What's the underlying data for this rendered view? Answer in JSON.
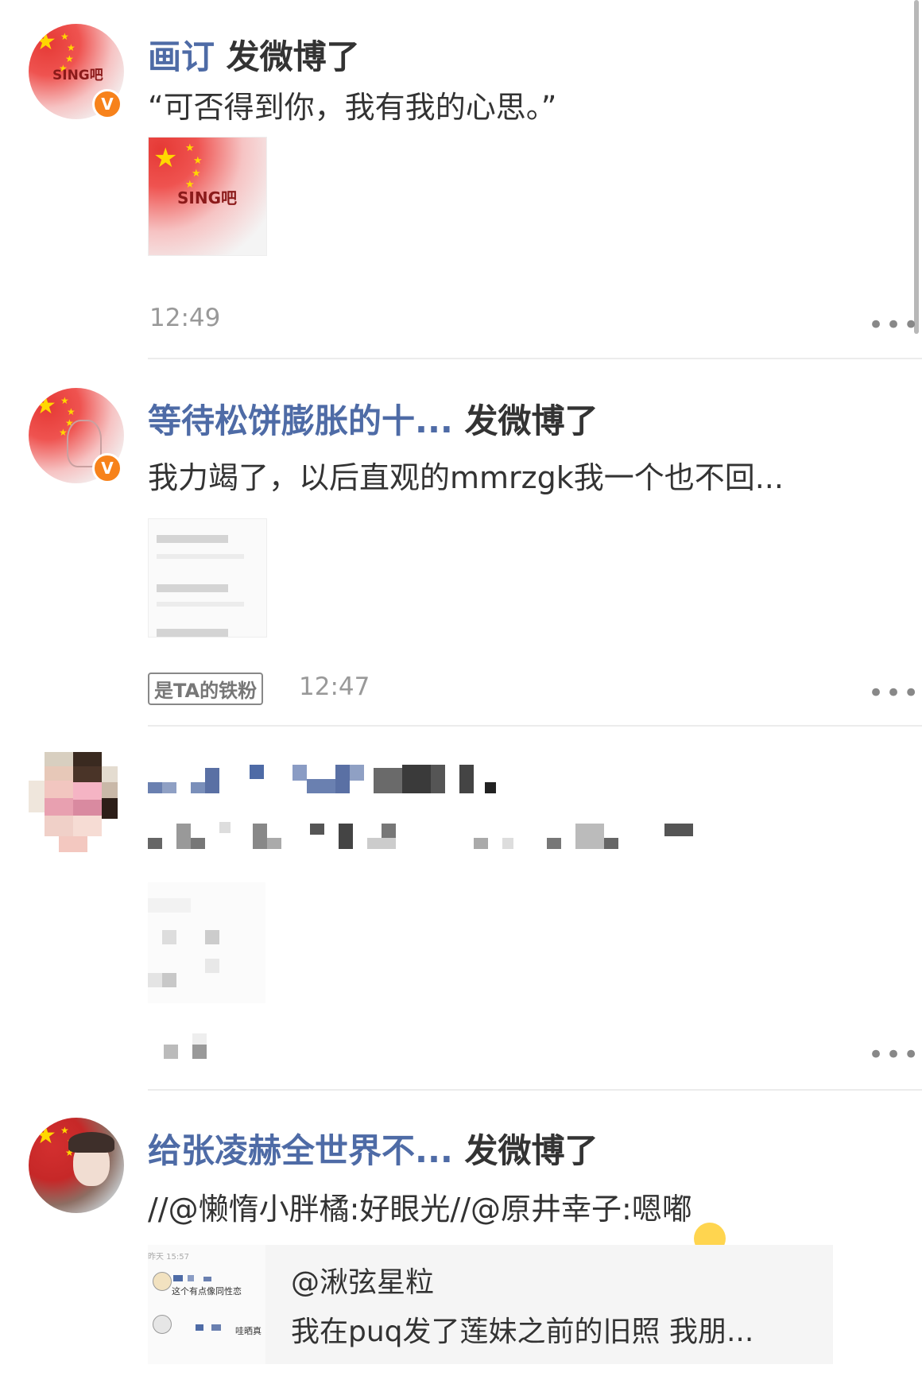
{
  "posts": [
    {
      "name": "画订",
      "action": "发微博了",
      "text": "“可否得到你，我有我的心思。”",
      "avatar_text": "SING吧",
      "image_text": "SING吧",
      "time": "12:49",
      "verified": "V"
    },
    {
      "name": "等待松饼膨胀的十...",
      "action": "发微博了",
      "text": "我力竭了，以后直观的mmrzgk我一个也不回...",
      "badge": "是TA的铁粉",
      "time": "12:47",
      "verified": "V"
    },
    {
      "name": "",
      "action": "",
      "text": ""
    },
    {
      "name": "给张凌赫全世界不...",
      "action": "发微博了",
      "text": "//@懒惰小胖橘:好眼光//@原井幸子:嗯嘟",
      "emoji": "😊",
      "repost": {
        "mention": "@湫弦星粒",
        "text": "我在puq发了莲妹之前的旧照 我朋...",
        "thumb_time": "昨天 15:57",
        "thumb_line1": "这个有点像同性恋",
        "thumb_line2": "哇晒真"
      }
    }
  ],
  "more_label": "•••",
  "colors": {
    "name": "#4e6ba6",
    "text": "#333333",
    "meta": "#999999",
    "verified": "#f7821b"
  }
}
